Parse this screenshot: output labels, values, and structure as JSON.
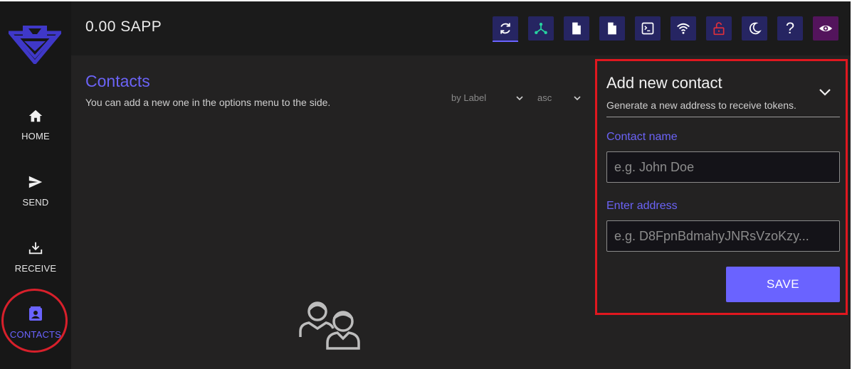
{
  "header": {
    "balance": "0.00 SAPP",
    "toolbar": [
      {
        "icon": "refresh-icon"
      },
      {
        "icon": "network-icon"
      },
      {
        "icon": "document-icon"
      },
      {
        "icon": "document-icon"
      },
      {
        "icon": "terminal-icon"
      },
      {
        "icon": "wifi-icon"
      },
      {
        "icon": "unlock-icon",
        "color": "#e0303a"
      },
      {
        "icon": "moon-icon"
      },
      {
        "icon": "help-icon",
        "label": "?"
      },
      {
        "icon": "eye-icon"
      }
    ]
  },
  "sidebar": {
    "items": [
      {
        "label": "HOME",
        "icon": "home-icon"
      },
      {
        "label": "SEND",
        "icon": "send-icon"
      },
      {
        "label": "RECEIVE",
        "icon": "download-icon"
      },
      {
        "label": "CONTACTS",
        "icon": "contact-card-icon",
        "active": true
      }
    ]
  },
  "main": {
    "title": "Contacts",
    "subtitle": "You can add a new one in the options menu to the side.",
    "sort_by": "by Label",
    "sort_order": "asc"
  },
  "panel": {
    "title": "Add new contact",
    "subtitle": "Generate a new address to receive tokens.",
    "name_label": "Contact name",
    "name_placeholder": "e.g. John Doe",
    "address_label": "Enter address",
    "address_placeholder": "e.g. D8FpnBdmahyJNRsVzoKzy...",
    "save_label": "SAVE"
  },
  "colors": {
    "accent": "#6a63ff",
    "highlight": "#e0171f",
    "background": "#232222"
  }
}
